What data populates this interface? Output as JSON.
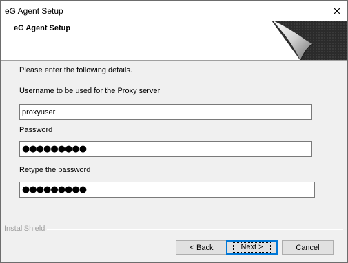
{
  "window": {
    "title": "eG Agent Setup"
  },
  "banner": {
    "title": "eG Agent Setup"
  },
  "form": {
    "intro": "Please enter the following details.",
    "username_label": "Username to be used for the Proxy server",
    "username_value": "proxyuser",
    "password_label": "Password",
    "password_value": "●●●●●●●●●",
    "retype_label": "Retype the password",
    "retype_value": "●●●●●●●●●"
  },
  "footer": {
    "brand": "InstallShield"
  },
  "buttons": {
    "back": "< Back",
    "next": "Next >",
    "cancel": "Cancel"
  },
  "colors": {
    "window_bg": "#f0f0f0",
    "focus_border": "#0078d7",
    "button_bg": "#e1e1e1"
  },
  "icons": {
    "close": "close-icon",
    "banner": "page-curl-graphic"
  }
}
